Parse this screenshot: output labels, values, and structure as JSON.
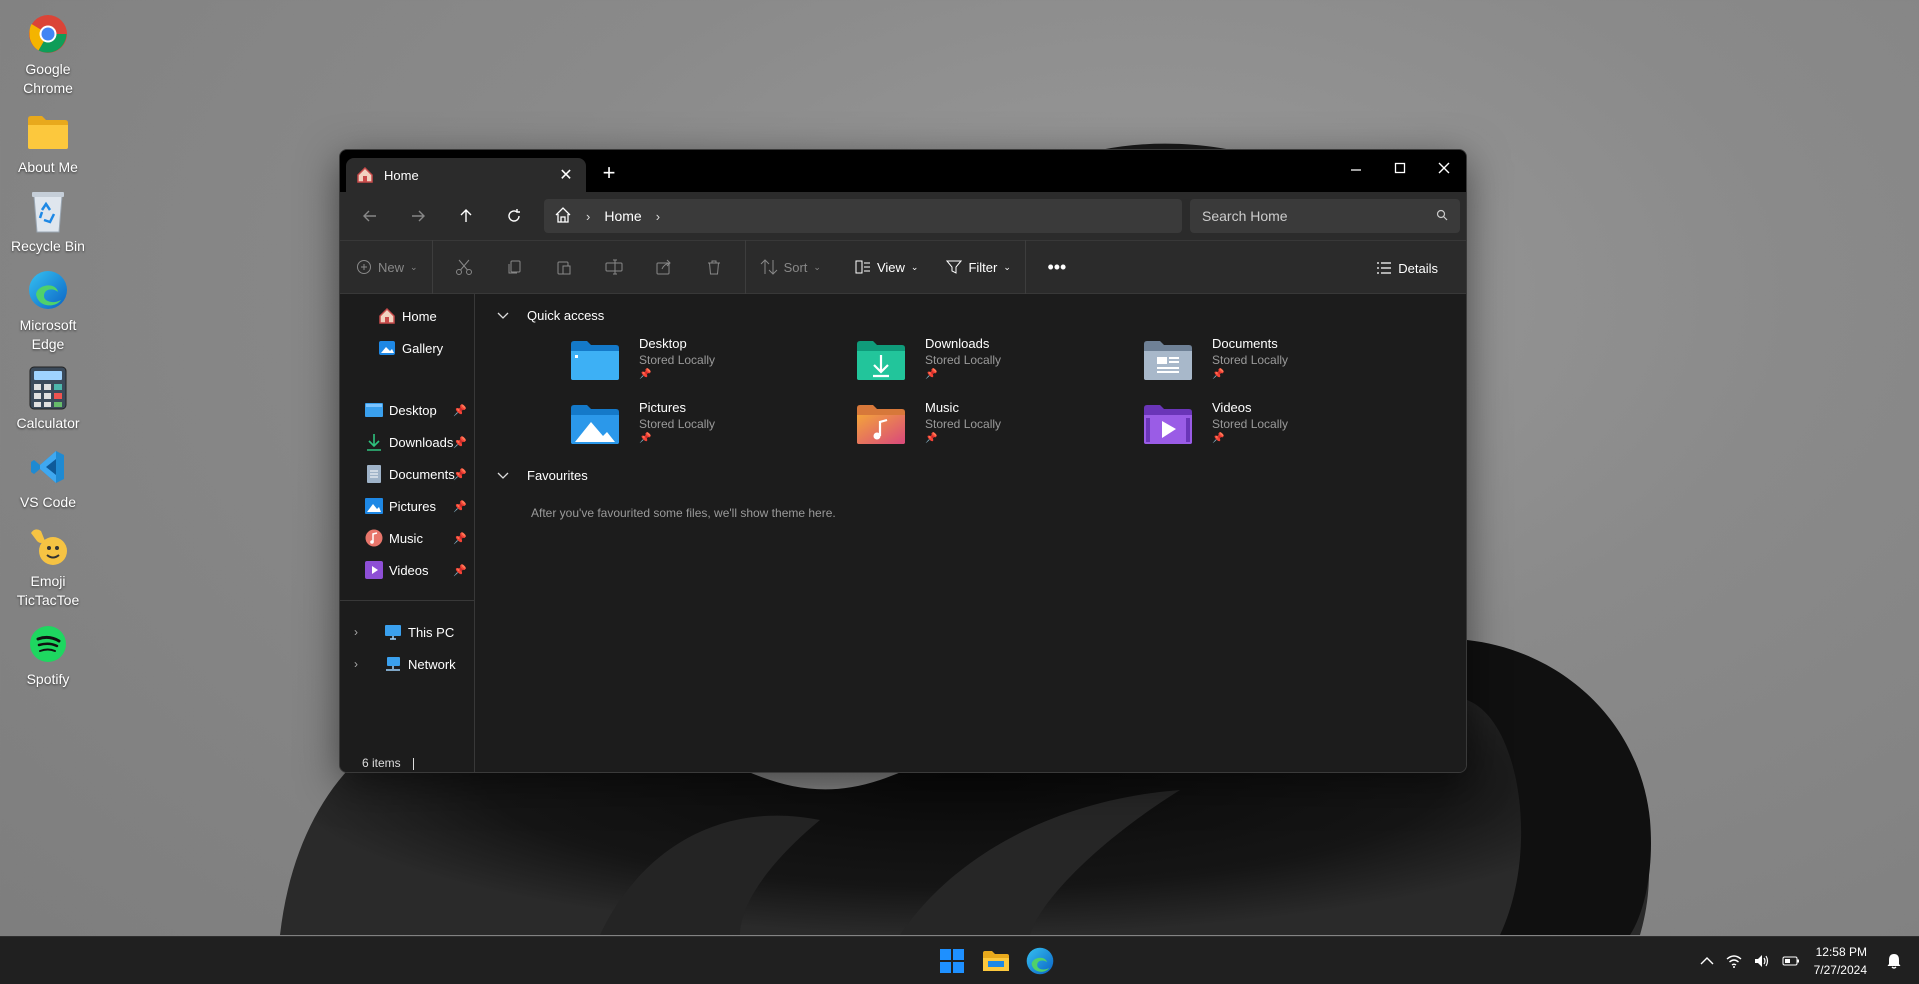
{
  "desktop": {
    "icons": [
      {
        "label": "Google Chrome",
        "icon": "chrome-icon"
      },
      {
        "label": "About Me",
        "icon": "folder-icon"
      },
      {
        "label": "Recycle Bin",
        "icon": "recycle-bin-icon"
      },
      {
        "label": "Microsoft Edge",
        "icon": "edge-icon"
      },
      {
        "label": "Calculator",
        "icon": "calculator-icon"
      },
      {
        "label": "VS Code",
        "icon": "vscode-icon"
      },
      {
        "label": "Emoji TicTacToe",
        "icon": "emoji-icon"
      },
      {
        "label": "Spotify",
        "icon": "spotify-icon"
      }
    ]
  },
  "window": {
    "tab_label": "Home",
    "address": {
      "crumb": "Home"
    },
    "search_placeholder": "Search Home",
    "toolbar": {
      "new_label": "New",
      "sort_label": "Sort",
      "view_label": "View",
      "filter_label": "Filter",
      "details_label": "Details"
    },
    "sidebar": {
      "top": [
        {
          "label": "Home"
        },
        {
          "label": "Gallery"
        }
      ],
      "pinned": [
        {
          "label": "Desktop"
        },
        {
          "label": "Downloads"
        },
        {
          "label": "Documents"
        },
        {
          "label": "Pictures"
        },
        {
          "label": "Music"
        },
        {
          "label": "Videos"
        }
      ],
      "drives": [
        {
          "label": "This PC"
        },
        {
          "label": "Network"
        }
      ]
    },
    "quick_access": {
      "title": "Quick access",
      "items": [
        {
          "name": "Desktop",
          "sub": "Stored Locally"
        },
        {
          "name": "Downloads",
          "sub": "Stored Locally"
        },
        {
          "name": "Documents",
          "sub": "Stored Locally"
        },
        {
          "name": "Pictures",
          "sub": "Stored Locally"
        },
        {
          "name": "Music",
          "sub": "Stored Locally"
        },
        {
          "name": "Videos",
          "sub": "Stored Locally"
        }
      ]
    },
    "favourites": {
      "title": "Favourites",
      "empty_text": "After you've favourited some files, we'll show theme here."
    },
    "status": "6 items"
  },
  "taskbar": {
    "time": "12:58 PM",
    "date": "7/27/2024"
  },
  "colors": {
    "window_bg": "#1c1c1c",
    "toolbar_bg": "#2b2b2b",
    "taskbar_bg": "#202020",
    "accent_blue": "#0078d4"
  }
}
